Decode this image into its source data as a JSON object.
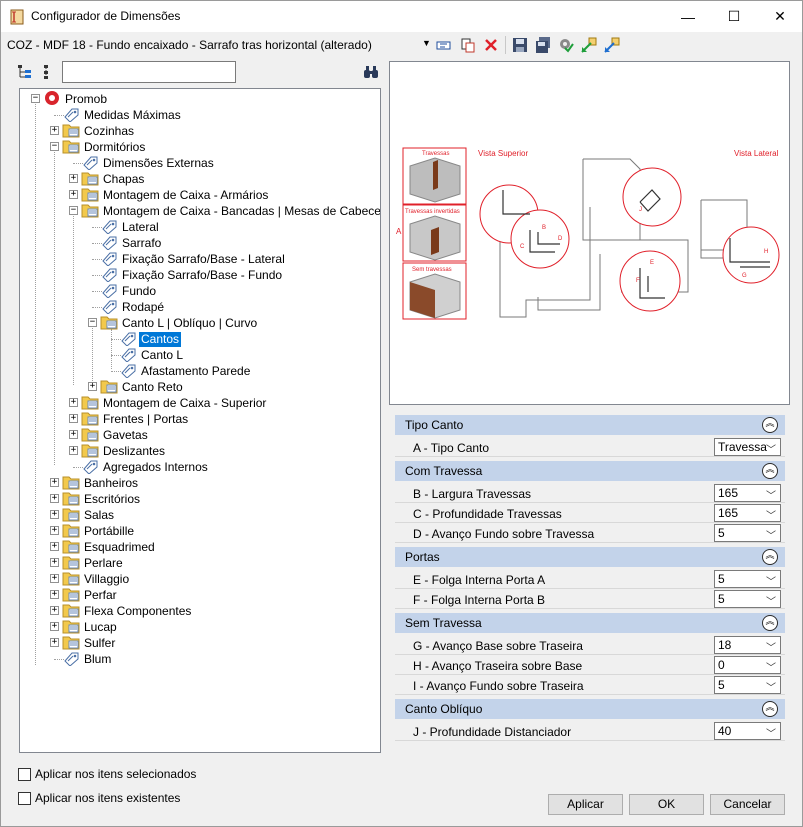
{
  "window": {
    "title": "Configurador de Dimensões",
    "minimize": "—",
    "maximize": "☐",
    "close": "✕"
  },
  "toolbar": {
    "document_title": "COZ - MDF 18 - Fundo encaixado - Sarrafo tras horizontal (alterado)",
    "dropdown_arrow": "▼"
  },
  "search": {
    "value": "",
    "placeholder": ""
  },
  "tree": {
    "items": [
      {
        "label": "Promob"
      },
      {
        "label": "Medidas Máximas"
      },
      {
        "label": "Cozinhas"
      },
      {
        "label": "Dormitórios"
      },
      {
        "label": "Dimensões Externas"
      },
      {
        "label": "Chapas"
      },
      {
        "label": "Montagem de Caixa - Armários"
      },
      {
        "label": "Montagem de Caixa - Bancadas | Mesas de Cabeceira"
      },
      {
        "label": "Lateral"
      },
      {
        "label": "Sarrafo"
      },
      {
        "label": "Fixação Sarrafo/Base - Lateral"
      },
      {
        "label": "Fixação Sarrafo/Base - Fundo"
      },
      {
        "label": "Fundo"
      },
      {
        "label": "Rodapé"
      },
      {
        "label": "Canto L | Oblíquo | Curvo"
      },
      {
        "label": "Cantos"
      },
      {
        "label": "Canto L"
      },
      {
        "label": "Afastamento Parede"
      },
      {
        "label": "Canto Reto"
      },
      {
        "label": "Montagem de Caixa - Superior"
      },
      {
        "label": "Frentes | Portas"
      },
      {
        "label": "Gavetas"
      },
      {
        "label": "Deslizantes"
      },
      {
        "label": "Agregados Internos"
      },
      {
        "label": "Banheiros"
      },
      {
        "label": "Escritórios"
      },
      {
        "label": "Salas"
      },
      {
        "label": "Portábille"
      },
      {
        "label": "Esquadrimed"
      },
      {
        "label": "Perlare"
      },
      {
        "label": "Villaggio"
      },
      {
        "label": "Perfar"
      },
      {
        "label": "Flexa Componentes"
      },
      {
        "label": "Lucap"
      },
      {
        "label": "Sulfer"
      },
      {
        "label": "Blum"
      }
    ],
    "expander_plus": "+",
    "expander_minus": "−"
  },
  "options": {
    "apply_selected": "Aplicar nos itens selecionados",
    "apply_existing": "Aplicar nos itens existentes"
  },
  "preview": {
    "thumb1_label": "Travessas",
    "thumb2_label": "Travessas invertidas",
    "thumb3_label": "Sem travessas",
    "label_a": "A",
    "vista_superior": "Vista Superior",
    "vista_lateral": "Vista Lateral",
    "letters": {
      "b": "B",
      "c": "C",
      "d": "D",
      "e": "E",
      "f": "F",
      "g": "G",
      "h": "H",
      "j": "J"
    },
    "accent_color": "#e0202a"
  },
  "properties": {
    "collapse_glyph": "︽",
    "sections": [
      {
        "title": "Tipo Canto",
        "rows": [
          {
            "label": "A - Tipo Canto",
            "value": "Travessa"
          }
        ]
      },
      {
        "title": "Com Travessa",
        "rows": [
          {
            "label": "B - Largura Travessas",
            "value": "165"
          },
          {
            "label": "C - Profundidade Travessas",
            "value": "165"
          },
          {
            "label": "D - Avanço Fundo sobre Travessa",
            "value": "5"
          }
        ]
      },
      {
        "title": "Portas",
        "rows": [
          {
            "label": "E - Folga Interna Porta A",
            "value": "5"
          },
          {
            "label": "F - Folga Interna Porta B",
            "value": "5"
          }
        ]
      },
      {
        "title": "Sem Travessa",
        "rows": [
          {
            "label": "G - Avanço Base sobre Traseira",
            "value": "18"
          },
          {
            "label": "H - Avanço Traseira sobre Base",
            "value": "0"
          },
          {
            "label": "I - Avanço Fundo sobre Traseira",
            "value": "5"
          }
        ]
      },
      {
        "title": "Canto Oblíquo",
        "rows": [
          {
            "label": "J - Profundidade Distanciador",
            "value": "40"
          }
        ]
      }
    ],
    "dropdown_glyph": "﹀"
  },
  "buttons": {
    "apply": "Aplicar",
    "ok": "OK",
    "cancel": "Cancelar"
  }
}
